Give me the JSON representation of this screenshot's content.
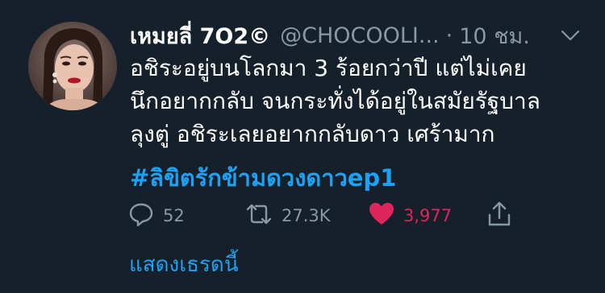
{
  "tweet": {
    "author": {
      "display_name": "เหมยลี่ 7O2©",
      "handle": "@CHOCOOLI...",
      "separator": "·",
      "time": "10 ชม."
    },
    "body_lines": [
      "อชิระอยู่บนโลกมา 3 ร้อยกว่าปี แต่ไม่เคย",
      "นึกอยากกลับ จนกระทั่งได้อยู่ในสมัยรัฐบาล",
      "ลุงตู่ อชิระเลยอยากกลับดาว เศร้ามาก"
    ],
    "hashtag": "#ลิขิตรักข้ามดวงดาวep1",
    "actions": {
      "reply_count": "52",
      "retweet_count": "27.3K",
      "like_count": "3,977"
    },
    "show_thread": "แสดงเธรดนี้"
  },
  "colors": {
    "background": "#15202b",
    "text": "#ffffff",
    "muted": "#8899a6",
    "accent": "#1da1f2",
    "like": "#e0245e"
  },
  "icons": [
    "reply-icon",
    "retweet-icon",
    "heart-icon",
    "share-icon",
    "chevron-down-icon"
  ]
}
